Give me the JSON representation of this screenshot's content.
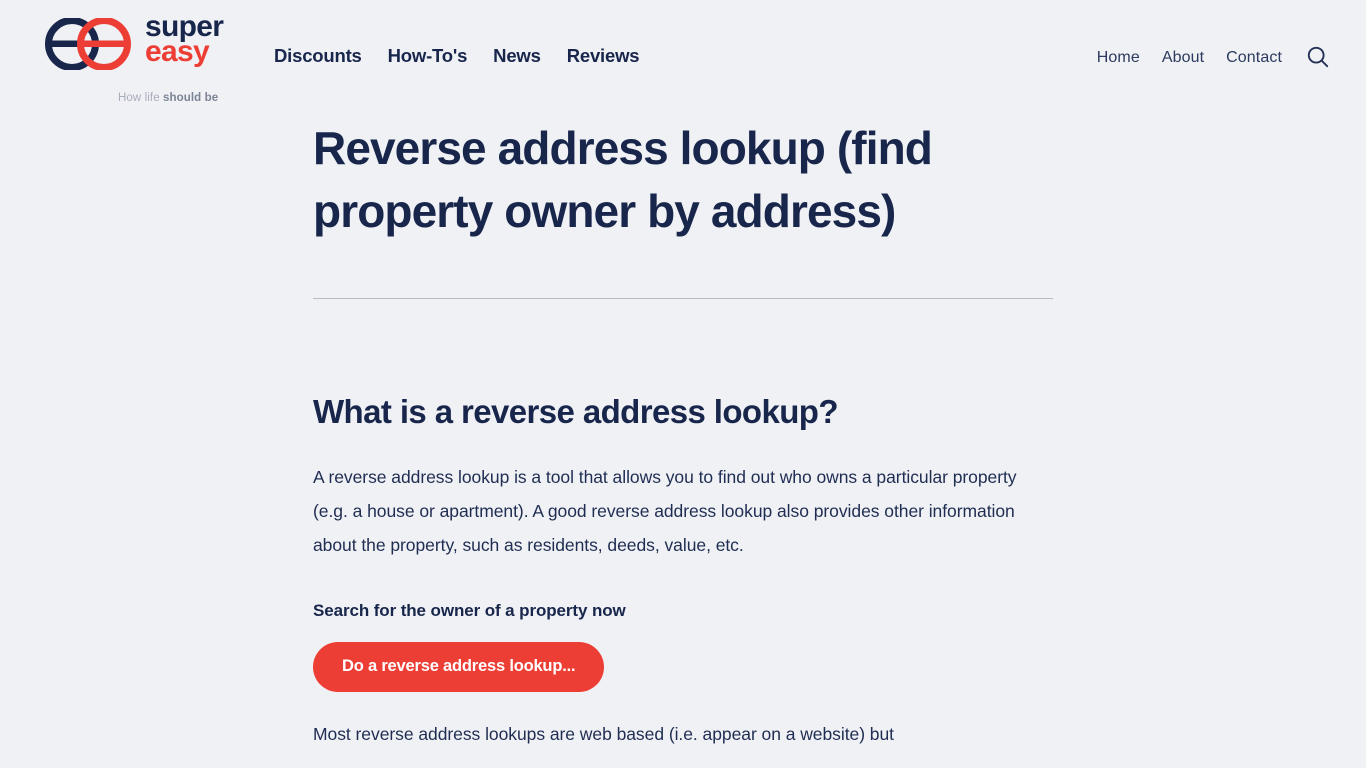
{
  "theme": {
    "background": "#f0f1f5",
    "navy": "#18264c",
    "red": "#ed3e35",
    "body_text": "#1f2d52",
    "divider": "#b9bcc6",
    "tagline_light": "#a8adbb",
    "tagline_bold": "#7d8496"
  },
  "header": {
    "logo": {
      "word_top": "super",
      "word_bottom": "easy",
      "tagline_light": "How life ",
      "tagline_bold": "should be",
      "mark_name": "double-e-logo"
    },
    "nav_main": [
      {
        "label": "Discounts"
      },
      {
        "label": "How-To's"
      },
      {
        "label": "News"
      },
      {
        "label": "Reviews"
      }
    ],
    "nav_right": [
      {
        "label": "Home"
      },
      {
        "label": "About"
      },
      {
        "label": "Contact"
      }
    ],
    "search_icon": "search-icon"
  },
  "main": {
    "page_title": "Reverse address lookup (find property owner by address)",
    "section_title": "What is a reverse address lookup?",
    "paragraph_1": "A reverse address lookup is a tool that allows you to find out who owns a particular property (e.g. a house or apartment). A good reverse address lookup also provides other information about the property, such as residents, deeds, value, etc.",
    "bold_lead": "Search for the owner of a property now",
    "cta_label": "Do a reverse address lookup...",
    "paragraph_2": "Most reverse address lookups are web based (i.e. appear on a website) but"
  }
}
